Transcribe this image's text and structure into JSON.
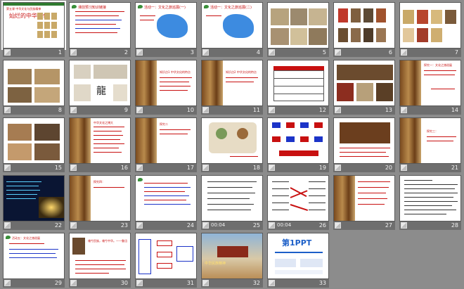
{
  "slides": [
    {
      "n": "1",
      "title": "灿烂的中华文化",
      "sub": "第五课 中华文化与民族精神"
    },
    {
      "n": "2",
      "title": "课前预习知识链接"
    },
    {
      "n": "3",
      "title": "活动一：文化之旅巡展(一)"
    },
    {
      "n": "4",
      "title": "活动一：文化之旅巡展(二)"
    },
    {
      "n": "5"
    },
    {
      "n": "6"
    },
    {
      "n": "7"
    },
    {
      "n": "8"
    },
    {
      "n": "9",
      "calligraphy": "龍"
    },
    {
      "n": "10",
      "title": "知识点1 中华文化的特点"
    },
    {
      "n": "11",
      "title": "知识点2 中华文化的特点"
    },
    {
      "n": "12"
    },
    {
      "n": "13"
    },
    {
      "n": "14",
      "title": "探究一：文化之旅巡展"
    },
    {
      "n": "15"
    },
    {
      "n": "16",
      "title": "中华文化之博大"
    },
    {
      "n": "17",
      "title": "探究二"
    },
    {
      "n": "18"
    },
    {
      "n": "19"
    },
    {
      "n": "20"
    },
    {
      "n": "21",
      "title": "探究三："
    },
    {
      "n": "22"
    },
    {
      "n": "23",
      "title": "探究四："
    },
    {
      "n": "24"
    },
    {
      "n": "25",
      "timer": "00:04"
    },
    {
      "n": "26",
      "timer": "00:04"
    },
    {
      "n": "27"
    },
    {
      "n": "28"
    },
    {
      "n": "29",
      "title": "活动五：文化之旅巡展"
    },
    {
      "n": "30",
      "quote": "魂兮民族，魂兮中华。——鲁迅"
    },
    {
      "n": "31"
    },
    {
      "n": "32",
      "stamp": "中华民族精神"
    },
    {
      "n": "33",
      "brand": "第1PPT"
    }
  ],
  "colors": {
    "bg": "#8c8c8c",
    "strip": "#6e6e6e",
    "title_red": "#c81010",
    "title_blue": "#1c34c8"
  }
}
